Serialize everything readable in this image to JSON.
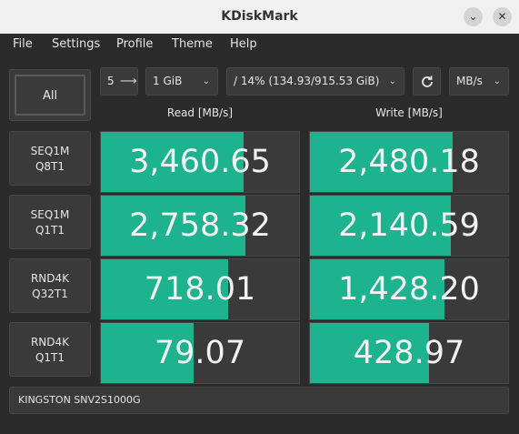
{
  "window": {
    "title": "KDiskMark",
    "minimize_icon": "chevron-down-icon",
    "close_icon": "close-icon"
  },
  "menu": [
    "File",
    "Settings",
    "Profile",
    "Theme",
    "Help"
  ],
  "controls": {
    "all_label": "All",
    "runs_value": "5",
    "size_value": "1 GiB",
    "path_value": "/ 14% (134.93/915.53 GiB)",
    "unit_value": "MB/s"
  },
  "columns": {
    "read": "Read [MB/s]",
    "write": "Write [MB/s]"
  },
  "tests": [
    {
      "line1": "SEQ1M",
      "line2": "Q8T1",
      "read": "3,460.65",
      "read_fill": 0.72,
      "write": "2,480.18",
      "write_fill": 0.72
    },
    {
      "line1": "SEQ1M",
      "line2": "Q1T1",
      "read": "2,758.32",
      "read_fill": 0.73,
      "write": "2,140.59",
      "write_fill": 0.71
    },
    {
      "line1": "RND4K",
      "line2": "Q32T1",
      "read": "718.01",
      "read_fill": 0.64,
      "write": "1,428.20",
      "write_fill": 0.68
    },
    {
      "line1": "RND4K",
      "line2": "Q1T1",
      "read": "79.07",
      "read_fill": 0.47,
      "write": "428.97",
      "write_fill": 0.6
    }
  ],
  "device": "KINGSTON SNV2S1000G",
  "colors": {
    "fill": "#1db38e",
    "background": "#2b2b2b",
    "panel": "#3a3a3a"
  }
}
